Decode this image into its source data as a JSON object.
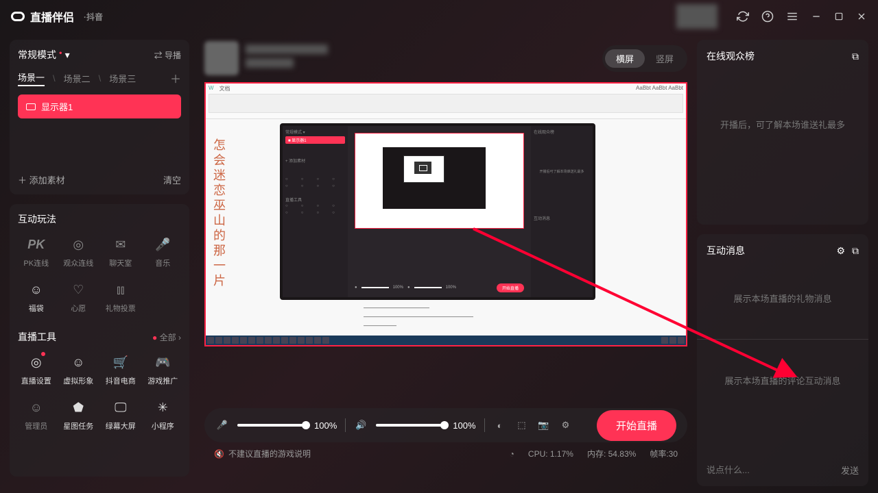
{
  "titlebar": {
    "app_name": "直播伴侣",
    "sub": "·抖音"
  },
  "sidebar": {
    "mode": "常规模式",
    "daobo": "导播",
    "scenes": [
      "场景一",
      "场景二",
      "场景三"
    ],
    "source_item": "显示器1",
    "add_source": "添加素材",
    "clear": "清空",
    "interact_title": "互动玩法",
    "interact_items": [
      {
        "label": "PK连线"
      },
      {
        "label": "观众连线"
      },
      {
        "label": "聊天室"
      },
      {
        "label": "音乐"
      },
      {
        "label": "福袋"
      },
      {
        "label": "心愿"
      },
      {
        "label": "礼物投票"
      }
    ],
    "tools_title": "直播工具",
    "all": "全部",
    "tools_items": [
      {
        "label": "直播设置"
      },
      {
        "label": "虚拟形象"
      },
      {
        "label": "抖音电商"
      },
      {
        "label": "游戏推广"
      },
      {
        "label": "管理员"
      },
      {
        "label": "星图任务"
      },
      {
        "label": "绿幕大屏"
      },
      {
        "label": "小程序"
      }
    ]
  },
  "center": {
    "orient_h": "横屏",
    "orient_v": "竖屏",
    "vert_text": "怎会迷恋巫山的那一片",
    "mic_pct": "100%",
    "spk_pct": "100%",
    "start_btn": "开始直播",
    "game_note": "不建议直播的游戏说明",
    "cpu": "CPU: 1.17%",
    "mem": "内存: 54.83%",
    "fps": "帧率:30"
  },
  "right": {
    "audience_title": "在线观众榜",
    "audience_placeholder": "开播后，可了解本场谁送礼最多",
    "msg_title": "互动消息",
    "gift_placeholder": "展示本场直播的礼物消息",
    "comment_placeholder": "展示本场直播的评论互动消息",
    "input_placeholder": "说点什么...",
    "send": "发送"
  }
}
